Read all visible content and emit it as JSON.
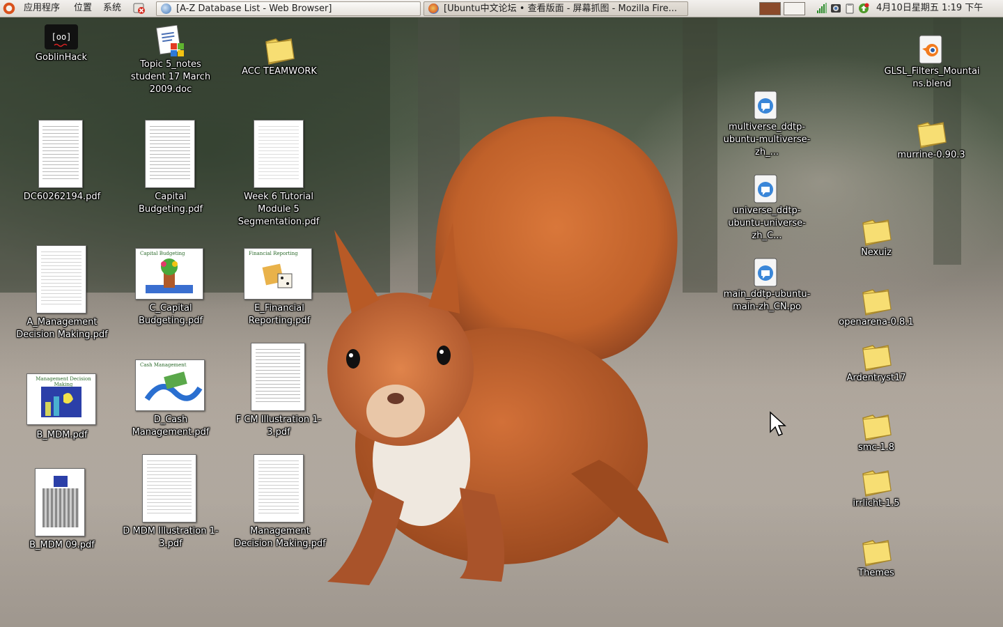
{
  "top_panel": {
    "menus": [
      "应用程序",
      "位置",
      "系统"
    ],
    "tasks": [
      {
        "label": "[A-Z Database List - Web Browser]"
      },
      {
        "label": "[Ubuntu中文论坛 • 查看版面 - 屏幕抓图 - Mozilla Fire..."
      }
    ],
    "clock": "4月10日星期五  1:19 下午",
    "workspace_colors": [
      "#8b4a2a",
      "#f4f2ee"
    ]
  },
  "desktop": {
    "icons": [
      {
        "name": "goblinhack",
        "label": "GoblinHack",
        "type": "app"
      },
      {
        "name": "topic5-notes",
        "label": "Topic 5_notes student 17 March 2009.doc",
        "type": "doc"
      },
      {
        "name": "acc-teamwork",
        "label": "ACC TEAMWORK",
        "type": "folder"
      },
      {
        "name": "dc60262194",
        "label": "DC60262194.pdf",
        "type": "pdf"
      },
      {
        "name": "capital-budgeting",
        "label": "Capital Budgeting.pdf",
        "type": "pdf"
      },
      {
        "name": "week6-tutorial",
        "label": "Week 6 Tutorial Module 5 Segmentation.pdf",
        "type": "pdf"
      },
      {
        "name": "a-management",
        "label": "A_Management Decision Making.pdf",
        "type": "pdf"
      },
      {
        "name": "c-capital",
        "label": "C_Capital Budgeting.pdf",
        "type": "pdf",
        "slide_title": "Capital Budgeting"
      },
      {
        "name": "e-financial",
        "label": "E_Financial Reporting.pdf",
        "type": "pdf",
        "slide_title": "Financial Reporting"
      },
      {
        "name": "b-mdm",
        "label": "B_MDM.pdf",
        "type": "pdf",
        "slide_title": "Management Decision Making"
      },
      {
        "name": "d-cash",
        "label": "D_Cash Management.pdf",
        "type": "pdf",
        "slide_title": "Cash Management"
      },
      {
        "name": "fcm-illustration",
        "label": "F CM Illustration 1-3.pdf",
        "type": "pdf"
      },
      {
        "name": "b-mdm-09",
        "label": "B_MDM 09.pdf",
        "type": "pdf"
      },
      {
        "name": "d-mdm-illustration",
        "label": "D MDM Illustration 1-3.pdf",
        "type": "pdf"
      },
      {
        "name": "management-decision",
        "label": "Management Decision Making.pdf",
        "type": "pdf"
      },
      {
        "name": "multiverse-po",
        "label": "multiverse_ddtp-ubuntu-multiverse-zh_...",
        "type": "po"
      },
      {
        "name": "universe-po",
        "label": "universe_ddtp-ubuntu-universe-zh_C...",
        "type": "po"
      },
      {
        "name": "main-po",
        "label": "main_ddtp-ubuntu-main-zh_CN.po",
        "type": "po"
      },
      {
        "name": "glsl-filters",
        "label": "GLSL_Filters_Mountains.blend",
        "type": "blend"
      },
      {
        "name": "murrine",
        "label": "murrine-0.90.3",
        "type": "folder"
      },
      {
        "name": "nexuiz",
        "label": "Nexuiz",
        "type": "folder"
      },
      {
        "name": "openarena",
        "label": "openarena-0.8.1",
        "type": "folder"
      },
      {
        "name": "ardentryst",
        "label": "Ardentryst17",
        "type": "folder"
      },
      {
        "name": "smc",
        "label": "smc-1.8",
        "type": "folder"
      },
      {
        "name": "irrlicht",
        "label": "irrlicht-1.5",
        "type": "folder"
      },
      {
        "name": "themes",
        "label": "Themes",
        "type": "folder"
      }
    ]
  }
}
